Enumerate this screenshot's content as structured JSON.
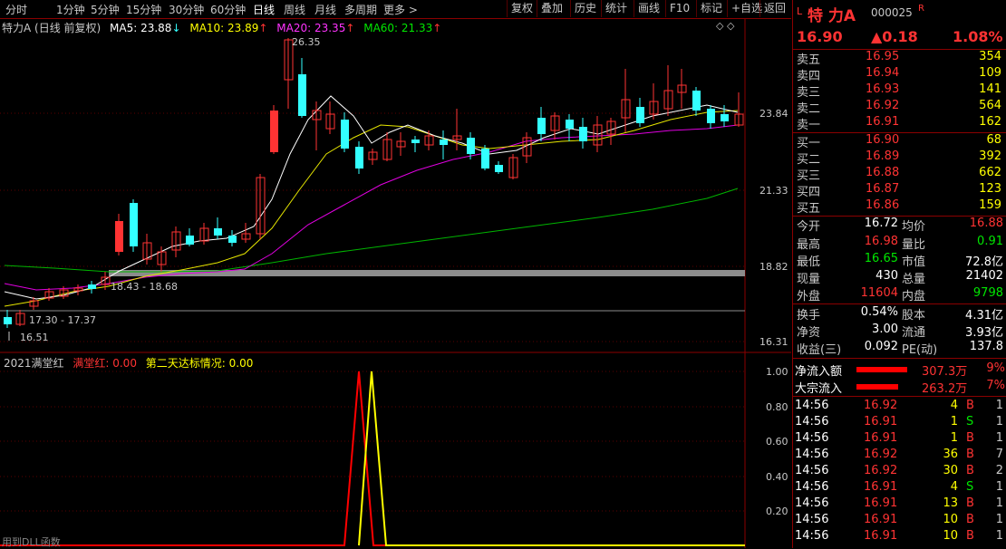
{
  "toolbar": {
    "periods": [
      "分时",
      "1分钟",
      "5分钟",
      "15分钟",
      "30分钟",
      "60分钟",
      "日线",
      "周线",
      "月线",
      "多周期",
      "更多 >"
    ],
    "active_period": "日线",
    "buttons": [
      "复权",
      "叠加",
      "历史",
      "统计",
      "画线",
      "F10",
      "标记",
      "+自选",
      "返回"
    ]
  },
  "chart_header": {
    "title": "特力A (日线 前复权)",
    "ma5": "MA5: 23.88",
    "ma5_arrow": "↓",
    "ma10": "MA10: 23.89",
    "ma10_arrow": "↑",
    "ma20": "MA20: 23.35",
    "ma20_arrow": "↑",
    "ma60": "MA60: 21.33",
    "ma60_arrow": "↑"
  },
  "price_axis": {
    "labels": [
      "23.84",
      "21.33",
      "18.82",
      "16.31"
    ]
  },
  "annotations": {
    "high": "26.35",
    "range1": "18.43 - 18.68",
    "range2": "17.30 - 17.37",
    "low": "16.51"
  },
  "indicator": {
    "name": "2021满堂红",
    "label1": "满堂红: 0.00",
    "label2": "第二天达标情况: 0.00",
    "axis": [
      "1.00",
      "0.80",
      "0.60",
      "0.40",
      "0.20"
    ],
    "footer": "用到DLL函数"
  },
  "quote": {
    "prefix": "L",
    "name": "特 力A",
    "code": "000025",
    "badge": "R",
    "price": "16.90",
    "change": "▲0.18",
    "change_pct": "1.08%"
  },
  "order_book": {
    "asks": [
      {
        "label": "卖五",
        "price": "16.95",
        "vol": "354"
      },
      {
        "label": "卖四",
        "price": "16.94",
        "vol": "109"
      },
      {
        "label": "卖三",
        "price": "16.93",
        "vol": "141"
      },
      {
        "label": "卖二",
        "price": "16.92",
        "vol": "564"
      },
      {
        "label": "卖一",
        "price": "16.91",
        "vol": "162"
      }
    ],
    "bids": [
      {
        "label": "买一",
        "price": "16.90",
        "vol": "68"
      },
      {
        "label": "买二",
        "price": "16.89",
        "vol": "392"
      },
      {
        "label": "买三",
        "price": "16.88",
        "vol": "662"
      },
      {
        "label": "买四",
        "price": "16.87",
        "vol": "123"
      },
      {
        "label": "买五",
        "price": "16.86",
        "vol": "159"
      }
    ]
  },
  "stats": [
    {
      "l1": "今开",
      "v1": "16.72",
      "l2": "均价",
      "v2": "16.88"
    },
    {
      "l1": "最高",
      "v1": "16.98",
      "l2": "量比",
      "v2": "0.91"
    },
    {
      "l1": "最低",
      "v1": "16.65",
      "l2": "市值",
      "v2": "72.8亿"
    },
    {
      "l1": "现量",
      "v1": "430",
      "l2": "总量",
      "v2": "21402"
    },
    {
      "l1": "外盘",
      "v1": "11604",
      "l2": "内盘",
      "v2": "9798"
    }
  ],
  "stats2": [
    {
      "l1": "换手",
      "v1": "0.54%",
      "l2": "股本",
      "v2": "4.31亿"
    },
    {
      "l1": "净资",
      "v1": "3.00",
      "l2": "流通",
      "v2": "3.93亿"
    },
    {
      "l1": "收益(三)",
      "v1": "0.092",
      "l2": "PE(动)",
      "v2": "137.8"
    }
  ],
  "flows": [
    {
      "label": "净流入额",
      "value": "307.3万",
      "pct": "9%"
    },
    {
      "label": "大宗流入",
      "value": "263.2万",
      "pct": "7%"
    }
  ],
  "ticks": [
    {
      "time": "14:56",
      "price": "16.92",
      "vol": "4",
      "side": "B",
      "n": "1"
    },
    {
      "time": "14:56",
      "price": "16.91",
      "vol": "1",
      "side": "S",
      "n": "1"
    },
    {
      "time": "14:56",
      "price": "16.91",
      "vol": "1",
      "side": "B",
      "n": "1"
    },
    {
      "time": "14:56",
      "price": "16.92",
      "vol": "36",
      "side": "B",
      "n": "7"
    },
    {
      "time": "14:56",
      "price": "16.92",
      "vol": "30",
      "side": "B",
      "n": "2"
    },
    {
      "time": "14:56",
      "price": "16.91",
      "vol": "4",
      "side": "S",
      "n": "1"
    },
    {
      "time": "14:56",
      "price": "16.91",
      "vol": "13",
      "side": "B",
      "n": "1"
    },
    {
      "time": "14:56",
      "price": "16.91",
      "vol": "10",
      "side": "B",
      "n": "1"
    },
    {
      "time": "14:56",
      "price": "16.91",
      "vol": "10",
      "side": "B",
      "n": "1"
    }
  ],
  "colors": {
    "up": "#ff3333",
    "down": "#33ffff",
    "frame": "#8b0000"
  }
}
